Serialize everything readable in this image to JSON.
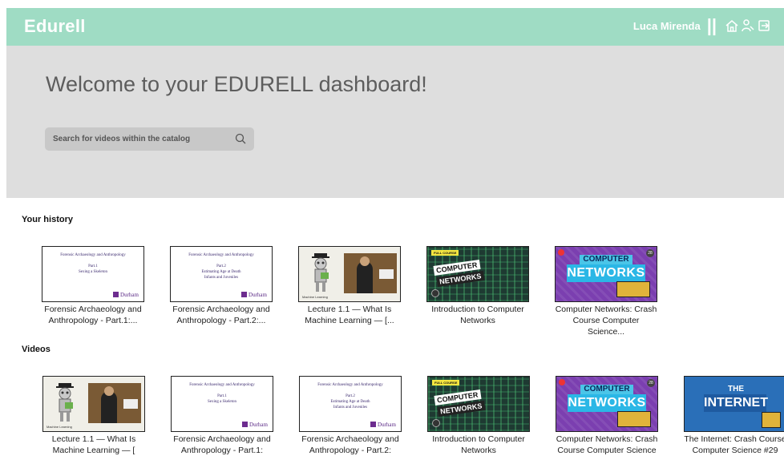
{
  "brand": "Edurell",
  "user": {
    "name": "Luca Mirenda",
    "separator": "||"
  },
  "nav_icons": [
    "home-icon",
    "user-key-icon",
    "logout-icon"
  ],
  "hero": {
    "title": "Welcome to your EDURELL dashboard!",
    "search_placeholder": "Search for videos within the catalog"
  },
  "sections": {
    "history": {
      "title": "Your history",
      "items": [
        {
          "caption": "Forensic Archaeology and Anthropology - Part.1:...",
          "thumb": "forensic",
          "t1": "Forensic Archaeology and Anthropology",
          "t2": "Part.1",
          "t3": "Sexing a Skeleton",
          "t4": "",
          "logo": "Durham"
        },
        {
          "caption": "Forensic Archaeology and Anthropology - Part.2:...",
          "thumb": "forensic",
          "t1": "Forensic Archaeology and Anthropology",
          "t2": "Part.2",
          "t3": "Estimating Age at Death",
          "t4": "Infants and Juveniles",
          "logo": "Durham"
        },
        {
          "caption": "Lecture 1.1 — What Is Machine Learning — [...",
          "thumb": "ml",
          "label": "Machine Learning"
        },
        {
          "caption": "Introduction to Computer Networks",
          "thumb": "net",
          "badge": "FULL COURSE",
          "w1": "COMPUTER",
          "w2": "NETWORKS"
        },
        {
          "caption": "Computer Networks: Crash Course Computer Science...",
          "thumb": "cc",
          "w1": "COMPUTER",
          "w2": "NETWORKS",
          "num": "28"
        }
      ]
    },
    "videos": {
      "title": "Videos",
      "items": [
        {
          "caption": "Lecture 1.1 — What Is Machine Learning — [",
          "thumb": "ml",
          "label": "Machine Learning"
        },
        {
          "caption": "Forensic Archaeology and Anthropology - Part.1:",
          "thumb": "forensic",
          "t1": "Forensic Archaeology and Anthropology",
          "t2": "Part.1",
          "t3": "Sexing a Skeleton",
          "t4": "",
          "logo": "Durham"
        },
        {
          "caption": "Forensic Archaeology and Anthropology - Part.2:",
          "thumb": "forensic",
          "t1": "Forensic Archaeology and Anthropology",
          "t2": "Part.2",
          "t3": "Estimating Age at Death",
          "t4": "Infants and Juveniles",
          "logo": "Durham"
        },
        {
          "caption": "Introduction to Computer Networks",
          "thumb": "net",
          "badge": "FULL COURSE",
          "w1": "COMPUTER",
          "w2": "NETWORKS"
        },
        {
          "caption": "Computer Networks: Crash Course Computer Science",
          "thumb": "cc",
          "w1": "COMPUTER",
          "w2": "NETWORKS",
          "num": "28"
        },
        {
          "caption": "The Internet: Crash Course Computer Science #29",
          "thumb": "int",
          "w1": "THE",
          "w2": "INTERNET"
        }
      ]
    }
  },
  "colors": {
    "navbar": "#9fdcc4",
    "hero": "#dedede",
    "search": "#c8c8c8"
  }
}
